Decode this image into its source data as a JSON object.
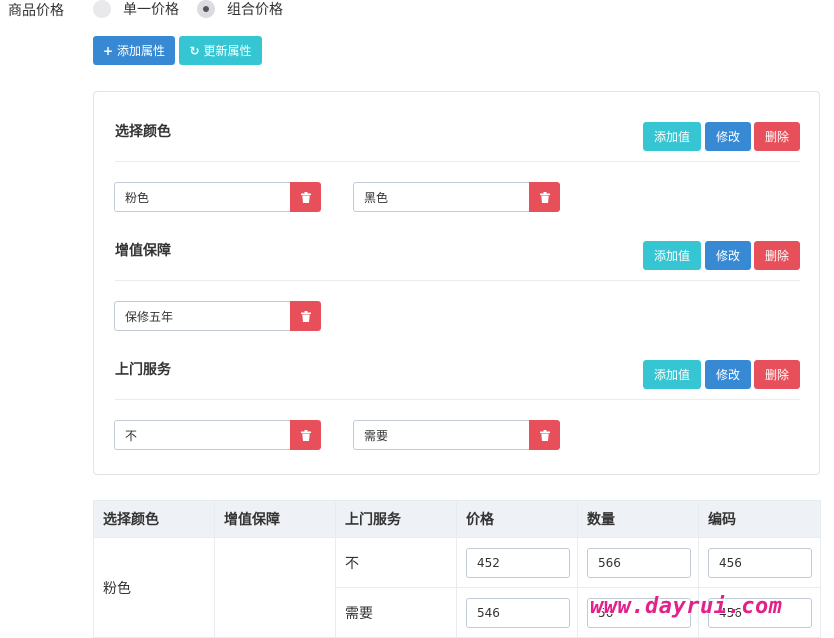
{
  "price": {
    "label": "商品价格",
    "options": [
      {
        "label": "单一价格",
        "checked": false
      },
      {
        "label": "组合价格",
        "checked": true
      }
    ]
  },
  "toolbar": {
    "add_attr": "添加属性",
    "update_attr": "更新属性"
  },
  "attrs": [
    {
      "title": "选择颜色",
      "values": [
        "粉色",
        "黑色"
      ]
    },
    {
      "title": "增值保障",
      "values": [
        "保修五年"
      ]
    },
    {
      "title": "上门服务",
      "values": [
        "不",
        "需要"
      ]
    }
  ],
  "attr_buttons": {
    "add_value": "添加值",
    "edit": "修改",
    "delete": "删除"
  },
  "table": {
    "headers": [
      "选择颜色",
      "增值保障",
      "上门服务",
      "价格",
      "数量",
      "编码"
    ],
    "color": "粉色",
    "rows": [
      {
        "service": "不",
        "price": "452",
        "qty": "566",
        "code": "456"
      },
      {
        "service": "需要",
        "price": "546",
        "qty": "56",
        "code": "456"
      }
    ]
  },
  "watermark": "www.dayrui.com",
  "colors": {
    "blue": "#3889d4",
    "cyan": "#36c6d3",
    "red": "#e7505a"
  }
}
